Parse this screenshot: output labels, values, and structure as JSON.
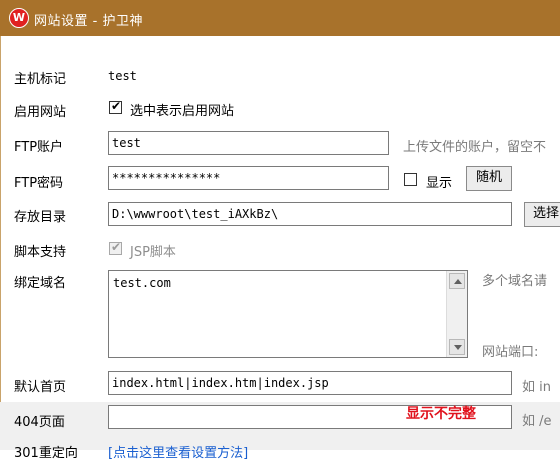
{
  "window": {
    "title": "网站设置 - 护卫神",
    "icon_letter": "W"
  },
  "form": {
    "host_label": "主机标记",
    "host_value": "test",
    "enable_label": "启用网站",
    "enable_checkbox_label": "选中表示启用网站",
    "enable_checked": true,
    "ftp_account_label": "FTP账户",
    "ftp_account_value": "test",
    "ftp_account_hint": "上传文件的账户，留空不",
    "ftp_password_label": "FTP密码",
    "ftp_password_value": "***************",
    "show_label": "显示",
    "random_button": "随机",
    "directory_label": "存放目录",
    "directory_value": "D:\\wwwroot\\test_iAXkBz\\",
    "select_button": "选择",
    "script_label": "脚本支持",
    "jsp_label": "JSP脚本",
    "jsp_checked": true,
    "domain_label": "绑定域名",
    "domain_value": "test.com",
    "domain_hint": "多个域名请",
    "port_label": "网站端口:",
    "default_page_label": "默认首页",
    "default_page_value": "index.html|index.htm|index.jsp",
    "default_page_hint": "如 in",
    "page404_label": "404页面",
    "page404_value": "",
    "page404_hint": "如 /e",
    "redirect_label": "301重定向",
    "redirect_link": "[点击这里查看设置方法]"
  },
  "overlay": {
    "incomplete_notice": "显示不完整"
  },
  "colors": {
    "titlebar": "#a8722b",
    "warning": "#e0121d",
    "link": "#1a5fd0"
  }
}
